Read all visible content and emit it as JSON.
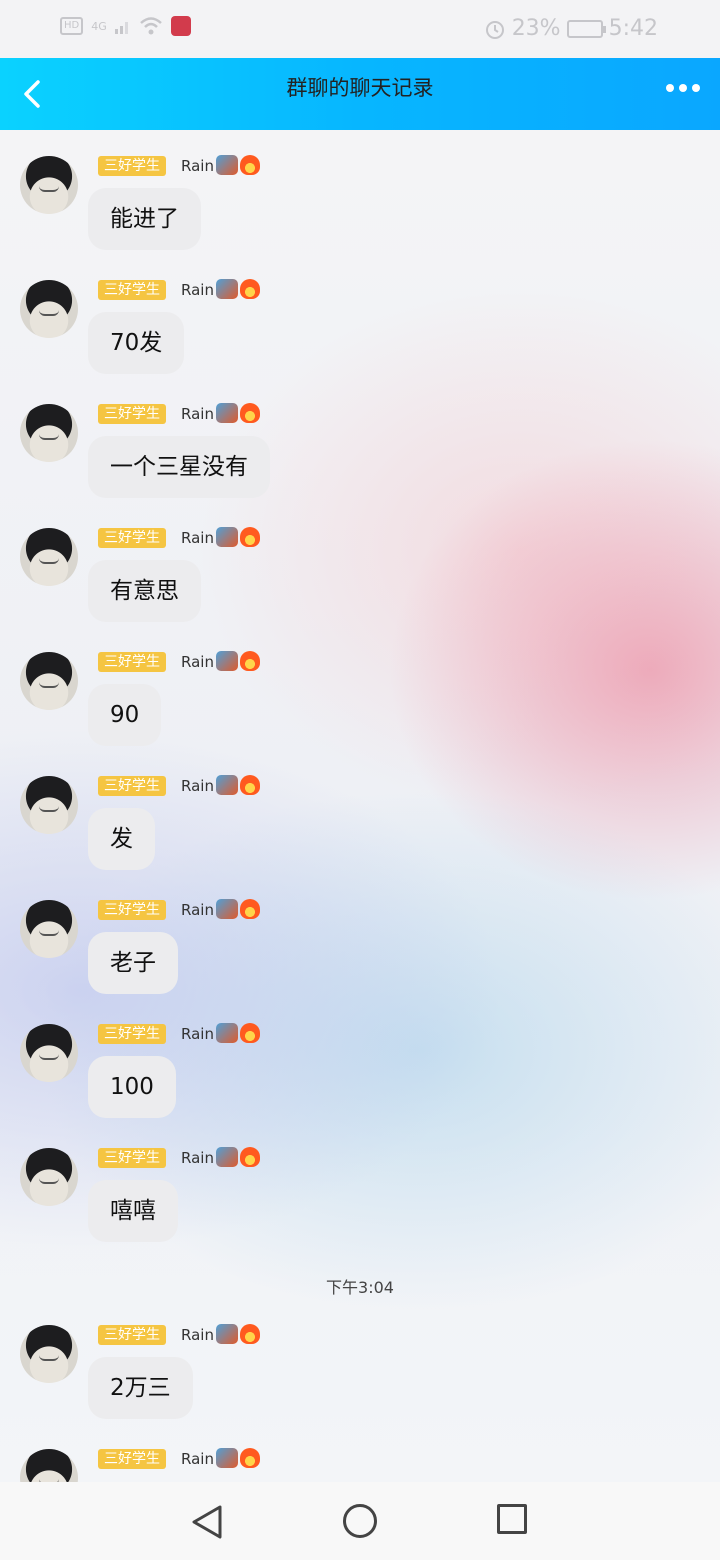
{
  "status_bar": {
    "network_labels": [
      "HD",
      "4G"
    ],
    "battery": "23%",
    "time": "5:42"
  },
  "header": {
    "title": "群聊的聊天记录",
    "back_icon": "chevron-left-icon",
    "more_icon": "more-dots-icon"
  },
  "sender": {
    "tag": "三好学生",
    "name": "Rain",
    "badges": [
      "dragon-badge-icon",
      "fire-badge-icon"
    ]
  },
  "messages": [
    {
      "text": "能进了"
    },
    {
      "text": "70发"
    },
    {
      "text": "一个三星没有"
    },
    {
      "text": "有意思"
    },
    {
      "text": "90"
    },
    {
      "text": "发"
    },
    {
      "text": "老子"
    },
    {
      "text": "100"
    },
    {
      "text": "嘻嘻"
    },
    {
      "text": "2万三"
    }
  ],
  "timestamp": "下午3:04",
  "nav": {
    "back_icon": "triangle-back-icon",
    "home_icon": "circle-home-icon",
    "recent_icon": "square-recents-icon"
  },
  "colors": {
    "header_gradient": [
      "#0ad2ff",
      "#0aa7ff"
    ],
    "tag_background": "#f5c542",
    "bubble_background": "#ececee"
  }
}
